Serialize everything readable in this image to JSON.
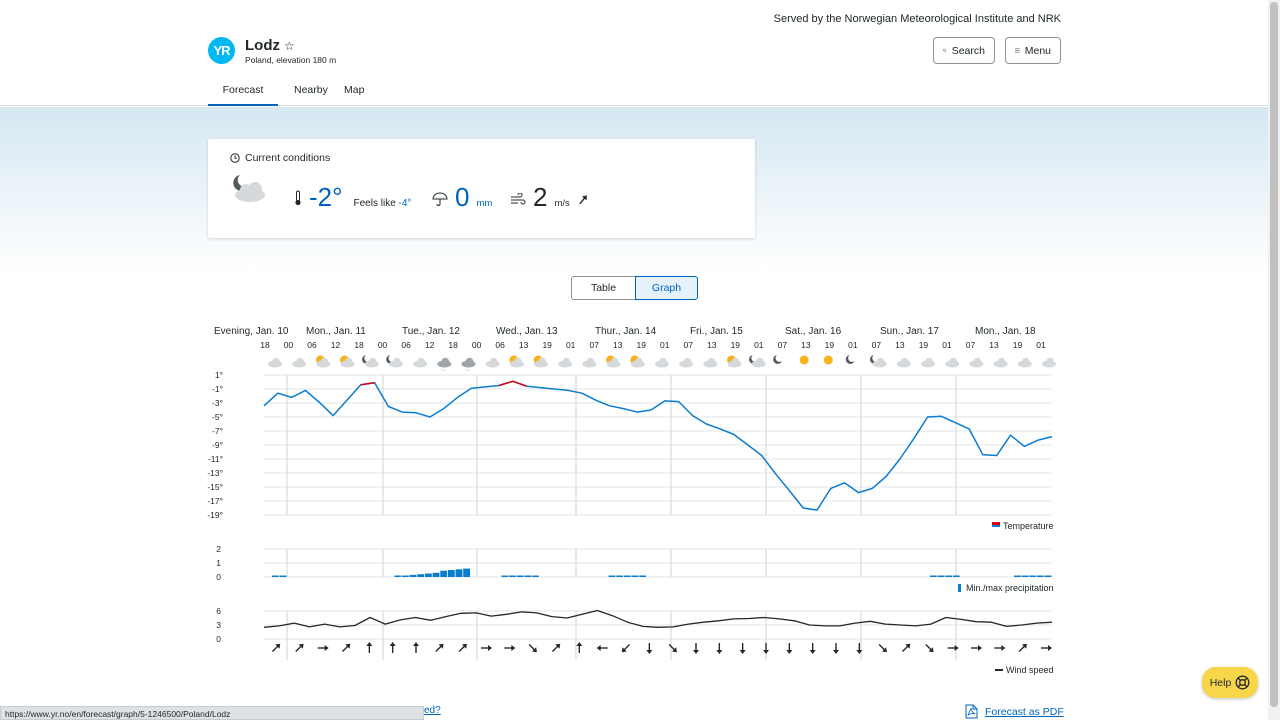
{
  "header": {
    "served_by": "Served by the Norwegian Meteorological Institute and NRK",
    "logo_text": "YR",
    "location_name": "Lodz",
    "location_sub": "Poland, elevation 180 m",
    "search_label": "Search",
    "menu_label": "Menu"
  },
  "tabs": [
    {
      "label": "Forecast",
      "active": true
    },
    {
      "label": "Nearby"
    },
    {
      "label": "Map"
    }
  ],
  "current": {
    "title": "Current conditions",
    "temp": "-2°",
    "feels_like_label": "Feels like",
    "feels_like_value": "-4°",
    "precip_value": "0",
    "precip_unit": "mm",
    "wind_value": "2",
    "wind_unit": "m/s",
    "icon": "partly-cloudy-night-icon"
  },
  "view_toggle": {
    "table": "Table",
    "graph": "Graph",
    "selected": "Graph"
  },
  "chart_data": {
    "type": "line",
    "days": [
      {
        "label": "Evening, Jan. 10",
        "hours": [
          "18"
        ]
      },
      {
        "label": "Mon., Jan. 11",
        "hours": [
          "00",
          "06",
          "12",
          "18"
        ]
      },
      {
        "label": "Tue., Jan. 12",
        "hours": [
          "00",
          "06",
          "12",
          "18"
        ]
      },
      {
        "label": "Wed., Jan. 13",
        "hours": [
          "00",
          "06",
          "13",
          "19"
        ]
      },
      {
        "label": "Thur., Jan. 14",
        "hours": [
          "01",
          "07",
          "13",
          "19"
        ]
      },
      {
        "label": "Fri., Jan. 15",
        "hours": [
          "01",
          "07",
          "13",
          "19"
        ]
      },
      {
        "label": "Sat., Jan. 16",
        "hours": [
          "01",
          "07",
          "13",
          "19"
        ]
      },
      {
        "label": "Sun., Jan. 17",
        "hours": [
          "01",
          "07",
          "13",
          "19"
        ]
      },
      {
        "label": "Mon., Jan. 18",
        "hours": [
          "01",
          "07",
          "13",
          "19",
          "01"
        ]
      }
    ],
    "symbols": [
      "cloud",
      "cloud",
      "partly-sunny",
      "partly-sunny",
      "cloud-night",
      "cloud-night",
      "cloud",
      "light-snow",
      "light-snow",
      "cloud",
      "partly-sunny",
      "partly-sunny",
      "cloud",
      "cloud",
      "partly-sunny",
      "partly-sunny",
      "cloud",
      "cloud",
      "cloud",
      "partly-sunny",
      "cloud-night",
      "night",
      "sun",
      "sun",
      "night",
      "cloud-night",
      "cloud",
      "cloud",
      "cloud",
      "cloud",
      "cloud",
      "cloud",
      "cloud"
    ],
    "temperature": {
      "name": "Temperature",
      "ylim": [
        -19,
        1
      ],
      "yticks": [
        "1°",
        "-1°",
        "-3°",
        "-5°",
        "-7°",
        "-9°",
        "-11°",
        "-13°",
        "-15°",
        "-17°",
        "-19°"
      ],
      "values": [
        -3.4,
        -1.6,
        -2.2,
        -1.2,
        -2.9,
        -4.8,
        -2.6,
        -0.4,
        -0.1,
        -3.5,
        -4.3,
        -4.4,
        -5.0,
        -3.8,
        -2.2,
        -0.9,
        -0.7,
        -0.5,
        0.1,
        -0.6,
        -0.8,
        -1.0,
        -1.2,
        -1.6,
        -2.6,
        -3.4,
        -3.8,
        -4.3,
        -4.0,
        -2.7,
        -2.8,
        -4.8,
        -6.0,
        -6.7,
        -7.5,
        -9.0,
        -10.5,
        -13.1,
        -15.5,
        -18.0,
        -18.3,
        -15.2,
        -14.4,
        -15.8,
        -15.2,
        -13.5,
        -11.0,
        -8.1,
        -5.0,
        -4.9,
        -5.8,
        -6.7,
        -10.4,
        -10.5,
        -7.6,
        -9.2,
        -8.3,
        -7.8
      ]
    },
    "precipitation": {
      "name": "Min./max precipitation",
      "ylim": [
        0,
        2
      ],
      "yticks": [
        "2",
        "1",
        "0"
      ],
      "values": [
        0,
        0.1,
        0.1,
        0,
        0,
        0,
        0,
        0,
        0,
        0,
        0,
        0,
        0,
        0,
        0,
        0,
        0,
        0.05,
        0.1,
        0.15,
        0.2,
        0.25,
        0.3,
        0.45,
        0.5,
        0.55,
        0.6,
        0,
        0,
        0,
        0,
        0.1,
        0.1,
        0.1,
        0.1,
        0.1,
        0,
        0,
        0,
        0,
        0,
        0,
        0,
        0,
        0,
        0.1,
        0.1,
        0.1,
        0.1,
        0.1,
        0,
        0,
        0,
        0,
        0,
        0,
        0,
        0,
        0,
        0,
        0,
        0,
        0,
        0,
        0,
        0,
        0,
        0,
        0,
        0,
        0,
        0,
        0,
        0,
        0,
        0,
        0,
        0,
        0,
        0,
        0,
        0,
        0,
        0,
        0,
        0,
        0,
        0.1,
        0.1,
        0.1,
        0.1,
        0,
        0,
        0,
        0,
        0,
        0,
        0,
        0.1,
        0.1,
        0.1,
        0.1,
        0.1
      ]
    },
    "wind": {
      "name": "Wind speed",
      "ylim": [
        0,
        6
      ],
      "yticks": [
        "6",
        "3",
        "0"
      ],
      "values": [
        2.5,
        2.8,
        3.4,
        2.6,
        3.2,
        2.6,
        2.9,
        4.6,
        3.2,
        4.1,
        4.6,
        4.0,
        4.8,
        5.5,
        5.6,
        4.9,
        5.3,
        5.8,
        5.6,
        4.8,
        4.5,
        5.3,
        6.1,
        5.0,
        3.6,
        2.7,
        2.5,
        2.6,
        3.2,
        3.6,
        3.9,
        4.3,
        4.4,
        4.6,
        4.3,
        3.9,
        3.0,
        2.8,
        2.8,
        3.4,
        3.8,
        3.2,
        3.0,
        2.8,
        3.2,
        4.6,
        4.2,
        3.7,
        3.6,
        2.7,
        3.0,
        3.4,
        3.6
      ]
    },
    "wind_arrows": [
      "arrow-ne",
      "arrow-ne",
      "arrow-e",
      "arrow-ne",
      "arrow-n",
      "arrow-n",
      "arrow-n",
      "arrow-ne",
      "arrow-ne",
      "arrow-e",
      "arrow-e",
      "arrow-se",
      "arrow-ne",
      "arrow-n",
      "arrow-w",
      "arrow-sw",
      "arrow-s",
      "arrow-se",
      "arrow-s",
      "arrow-s",
      "arrow-s",
      "arrow-s",
      "arrow-s",
      "arrow-s",
      "arrow-s",
      "arrow-s",
      "arrow-se",
      "arrow-ne",
      "arrow-se",
      "arrow-e",
      "arrow-e",
      "arrow-e",
      "arrow-ne",
      "arrow-e"
    ],
    "grid": true,
    "legend_placement": "bottom-right"
  },
  "footer": {
    "status_url": "https://www.yr.no/en/forecast/graph/5-1246500/Poland/Lodz",
    "cut_text": "ed?",
    "pdf_label": "Forecast as PDF",
    "help_label": "Help"
  },
  "colors": {
    "accent": "#0062ba",
    "temp_line": "#0b7dcf",
    "temp_warm": "#d6000f",
    "help_bg": "#f8d649",
    "logo": "#00b8f1"
  }
}
